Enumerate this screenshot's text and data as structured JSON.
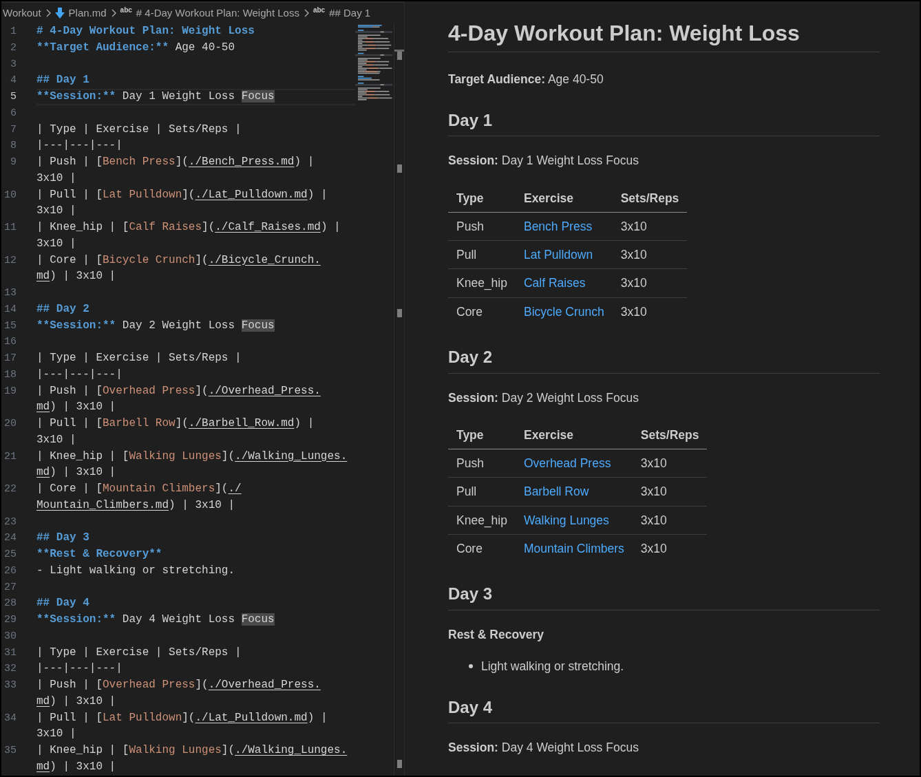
{
  "breadcrumb": [
    {
      "text": "Workout",
      "kind": "folder"
    },
    {
      "text": "Plan.md",
      "kind": "file"
    },
    {
      "text": "# 4-Day Workout Plan: Weight Loss",
      "kind": "symbol",
      "icon_text": "abc"
    },
    {
      "text": "## Day 1",
      "kind": "symbol",
      "icon_text": "abc"
    }
  ],
  "editor": {
    "lines": [
      {
        "number": "1",
        "current": false,
        "rows": [
          {
            "tokens": [
              {
                "kind": "heading",
                "text": "# 4-Day Workout Plan: Weight Loss"
              }
            ]
          }
        ]
      },
      {
        "number": "2",
        "current": false,
        "rows": [
          {
            "tokens": [
              {
                "kind": "bold",
                "text": "**Target Audience:**"
              },
              {
                "kind": "plain",
                "text": " Age 40-50"
              }
            ]
          }
        ]
      },
      {
        "number": "3",
        "current": false
      },
      {
        "number": "4",
        "current": false,
        "rows": [
          {
            "tokens": [
              {
                "kind": "heading",
                "text": "## Day 1"
              }
            ]
          }
        ]
      },
      {
        "number": "5",
        "current": true,
        "rows": [
          {
            "tokens": [
              {
                "kind": "bold",
                "text": "**Session:**"
              },
              {
                "kind": "plain",
                "text": " Day 1 Weight Loss "
              },
              {
                "kind": "match",
                "text": "Focus"
              }
            ]
          }
        ]
      },
      {
        "number": "6",
        "current": false
      },
      {
        "number": "7",
        "current": false,
        "rows": [
          {
            "tokens": [
              {
                "kind": "plain",
                "text": "| Type | Exercise | Sets/Reps |"
              }
            ]
          }
        ]
      },
      {
        "number": "8",
        "current": false,
        "rows": [
          {
            "tokens": [
              {
                "kind": "plain",
                "text": "|---|---|---|"
              }
            ]
          }
        ]
      },
      {
        "number": "9",
        "current": false,
        "rows": [
          {
            "tokens": [
              {
                "kind": "plain",
                "text": "| Push | ["
              },
              {
                "kind": "link",
                "text": "Bench Press"
              },
              {
                "kind": "plain",
                "text": "]("
              },
              {
                "kind": "url",
                "text": "./Bench_Press.md"
              },
              {
                "kind": "plain",
                "text": ") |"
              }
            ]
          },
          {
            "tokens": [
              {
                "kind": "plain",
                "text": "3x10 |"
              }
            ]
          }
        ]
      },
      {
        "number": "10",
        "current": false,
        "rows": [
          {
            "tokens": [
              {
                "kind": "plain",
                "text": "| Pull | ["
              },
              {
                "kind": "link",
                "text": "Lat Pulldown"
              },
              {
                "kind": "plain",
                "text": "]("
              },
              {
                "kind": "url",
                "text": "./Lat_Pulldown.md"
              },
              {
                "kind": "plain",
                "text": ") |"
              }
            ]
          },
          {
            "tokens": [
              {
                "kind": "plain",
                "text": "3x10 |"
              }
            ]
          }
        ]
      },
      {
        "number": "11",
        "current": false,
        "rows": [
          {
            "tokens": [
              {
                "kind": "plain",
                "text": "| Knee_hip | ["
              },
              {
                "kind": "link",
                "text": "Calf Raises"
              },
              {
                "kind": "plain",
                "text": "]("
              },
              {
                "kind": "url",
                "text": "./Calf_Raises.md"
              },
              {
                "kind": "plain",
                "text": ") |"
              }
            ]
          },
          {
            "tokens": [
              {
                "kind": "plain",
                "text": "3x10 |"
              }
            ]
          }
        ]
      },
      {
        "number": "12",
        "current": false,
        "rows": [
          {
            "tokens": [
              {
                "kind": "plain",
                "text": "| Core | ["
              },
              {
                "kind": "link",
                "text": "Bicycle Crunch"
              },
              {
                "kind": "plain",
                "text": "]("
              },
              {
                "kind": "url",
                "text": "./Bicycle_Crunch."
              }
            ]
          },
          {
            "tokens": [
              {
                "kind": "url",
                "text": "md"
              },
              {
                "kind": "plain",
                "text": ") | 3x10 |"
              }
            ]
          }
        ]
      },
      {
        "number": "13",
        "current": false
      },
      {
        "number": "14",
        "current": false,
        "rows": [
          {
            "tokens": [
              {
                "kind": "heading",
                "text": "## Day 2"
              }
            ]
          }
        ]
      },
      {
        "number": "15",
        "current": false,
        "rows": [
          {
            "tokens": [
              {
                "kind": "bold",
                "text": "**Session:**"
              },
              {
                "kind": "plain",
                "text": " Day 2 Weight Loss "
              },
              {
                "kind": "match",
                "text": "Focus"
              }
            ]
          }
        ]
      },
      {
        "number": "16",
        "current": false
      },
      {
        "number": "17",
        "current": false,
        "rows": [
          {
            "tokens": [
              {
                "kind": "plain",
                "text": "| Type | Exercise | Sets/Reps |"
              }
            ]
          }
        ]
      },
      {
        "number": "18",
        "current": false,
        "rows": [
          {
            "tokens": [
              {
                "kind": "plain",
                "text": "|---|---|---|"
              }
            ]
          }
        ]
      },
      {
        "number": "19",
        "current": false,
        "rows": [
          {
            "tokens": [
              {
                "kind": "plain",
                "text": "| Push | ["
              },
              {
                "kind": "link",
                "text": "Overhead Press"
              },
              {
                "kind": "plain",
                "text": "]("
              },
              {
                "kind": "url",
                "text": "./Overhead_Press."
              }
            ]
          },
          {
            "tokens": [
              {
                "kind": "url",
                "text": "md"
              },
              {
                "kind": "plain",
                "text": ") | 3x10 |"
              }
            ]
          }
        ]
      },
      {
        "number": "20",
        "current": false,
        "rows": [
          {
            "tokens": [
              {
                "kind": "plain",
                "text": "| Pull | ["
              },
              {
                "kind": "link",
                "text": "Barbell Row"
              },
              {
                "kind": "plain",
                "text": "]("
              },
              {
                "kind": "url",
                "text": "./Barbell_Row.md"
              },
              {
                "kind": "plain",
                "text": ") |"
              }
            ]
          },
          {
            "tokens": [
              {
                "kind": "plain",
                "text": "3x10 |"
              }
            ]
          }
        ]
      },
      {
        "number": "21",
        "current": false,
        "rows": [
          {
            "tokens": [
              {
                "kind": "plain",
                "text": "| Knee_hip | ["
              },
              {
                "kind": "link",
                "text": "Walking Lunges"
              },
              {
                "kind": "plain",
                "text": "]("
              },
              {
                "kind": "url",
                "text": "./Walking_Lunges."
              }
            ]
          },
          {
            "tokens": [
              {
                "kind": "url",
                "text": "md"
              },
              {
                "kind": "plain",
                "text": ") | 3x10 |"
              }
            ]
          }
        ]
      },
      {
        "number": "22",
        "current": false,
        "rows": [
          {
            "tokens": [
              {
                "kind": "plain",
                "text": "| Core | ["
              },
              {
                "kind": "link",
                "text": "Mountain Climbers"
              },
              {
                "kind": "plain",
                "text": "]("
              },
              {
                "kind": "url",
                "text": "./"
              }
            ]
          },
          {
            "tokens": [
              {
                "kind": "url",
                "text": "Mountain_Climbers.md"
              },
              {
                "kind": "plain",
                "text": ") | 3x10 |"
              }
            ]
          }
        ]
      },
      {
        "number": "23",
        "current": false
      },
      {
        "number": "24",
        "current": false,
        "rows": [
          {
            "tokens": [
              {
                "kind": "heading",
                "text": "## Day 3"
              }
            ]
          }
        ]
      },
      {
        "number": "25",
        "current": false,
        "rows": [
          {
            "tokens": [
              {
                "kind": "bold",
                "text": "**Rest & Recovery**"
              }
            ]
          }
        ]
      },
      {
        "number": "26",
        "current": false,
        "rows": [
          {
            "tokens": [
              {
                "kind": "plain",
                "text": "- Light walking or stretching."
              }
            ]
          }
        ]
      },
      {
        "number": "27",
        "current": false
      },
      {
        "number": "28",
        "current": false,
        "rows": [
          {
            "tokens": [
              {
                "kind": "heading",
                "text": "## Day 4"
              }
            ]
          }
        ]
      },
      {
        "number": "29",
        "current": false,
        "rows": [
          {
            "tokens": [
              {
                "kind": "bold",
                "text": "**Session:**"
              },
              {
                "kind": "plain",
                "text": " Day 4 Weight Loss "
              },
              {
                "kind": "match",
                "text": "Focus"
              }
            ]
          }
        ]
      },
      {
        "number": "30",
        "current": false
      },
      {
        "number": "31",
        "current": false,
        "rows": [
          {
            "tokens": [
              {
                "kind": "plain",
                "text": "| Type | Exercise | Sets/Reps |"
              }
            ]
          }
        ]
      },
      {
        "number": "32",
        "current": false,
        "rows": [
          {
            "tokens": [
              {
                "kind": "plain",
                "text": "|---|---|---|"
              }
            ]
          }
        ]
      },
      {
        "number": "33",
        "current": false,
        "rows": [
          {
            "tokens": [
              {
                "kind": "plain",
                "text": "| Push | ["
              },
              {
                "kind": "link",
                "text": "Overhead Press"
              },
              {
                "kind": "plain",
                "text": "]("
              },
              {
                "kind": "url",
                "text": "./Overhead_Press."
              }
            ]
          },
          {
            "tokens": [
              {
                "kind": "url",
                "text": "md"
              },
              {
                "kind": "plain",
                "text": ") | 3x10 |"
              }
            ]
          }
        ]
      },
      {
        "number": "34",
        "current": false,
        "rows": [
          {
            "tokens": [
              {
                "kind": "plain",
                "text": "| Pull | ["
              },
              {
                "kind": "link",
                "text": "Lat Pulldown"
              },
              {
                "kind": "plain",
                "text": "]("
              },
              {
                "kind": "url",
                "text": "./Lat_Pulldown.md"
              },
              {
                "kind": "plain",
                "text": ") |"
              }
            ]
          },
          {
            "tokens": [
              {
                "kind": "plain",
                "text": "3x10 |"
              }
            ]
          }
        ]
      },
      {
        "number": "35",
        "current": false,
        "rows": [
          {
            "tokens": [
              {
                "kind": "plain",
                "text": "| Knee_hip | ["
              },
              {
                "kind": "link",
                "text": "Walking Lunges"
              },
              {
                "kind": "plain",
                "text": "]("
              },
              {
                "kind": "url",
                "text": "./Walking_Lunges."
              }
            ]
          },
          {
            "tokens": [
              {
                "kind": "url",
                "text": "md"
              },
              {
                "kind": "plain",
                "text": ") | 3x10 |"
              }
            ]
          }
        ]
      }
    ]
  },
  "preview": {
    "title": "4-Day Workout Plan: Weight Loss",
    "intro": "**Target Audience:** Age 40-50",
    "days": [
      {
        "heading": "Day 1",
        "session": "**Session:** Day 1 Weight Loss Focus",
        "table": {
          "columns": [
            "Type",
            "Exercise",
            "Sets/Reps"
          ],
          "rows": [
            {
              "type": "Push",
              "exercise": "Bench Press",
              "sets": "3x10"
            },
            {
              "type": "Pull",
              "exercise": "Lat Pulldown",
              "sets": "3x10"
            },
            {
              "type": "Knee_hip",
              "exercise": "Calf Raises",
              "sets": "3x10"
            },
            {
              "type": "Core",
              "exercise": "Bicycle Crunch",
              "sets": "3x10"
            }
          ]
        }
      },
      {
        "heading": "Day 2",
        "session": "**Session:** Day 2 Weight Loss Focus",
        "table": {
          "columns": [
            "Type",
            "Exercise",
            "Sets/Reps"
          ],
          "rows": [
            {
              "type": "Push",
              "exercise": "Overhead Press",
              "sets": "3x10"
            },
            {
              "type": "Pull",
              "exercise": "Barbell Row",
              "sets": "3x10"
            },
            {
              "type": "Knee_hip",
              "exercise": "Walking Lunges",
              "sets": "3x10"
            },
            {
              "type": "Core",
              "exercise": "Mountain Climbers",
              "sets": "3x10"
            }
          ]
        }
      },
      {
        "heading": "Day 3",
        "note": "Rest & Recovery",
        "bullets": [
          "Light walking or stretching."
        ]
      },
      {
        "heading": "Day 4",
        "session": "**Session:** Day 4 Weight Loss Focus"
      }
    ]
  }
}
